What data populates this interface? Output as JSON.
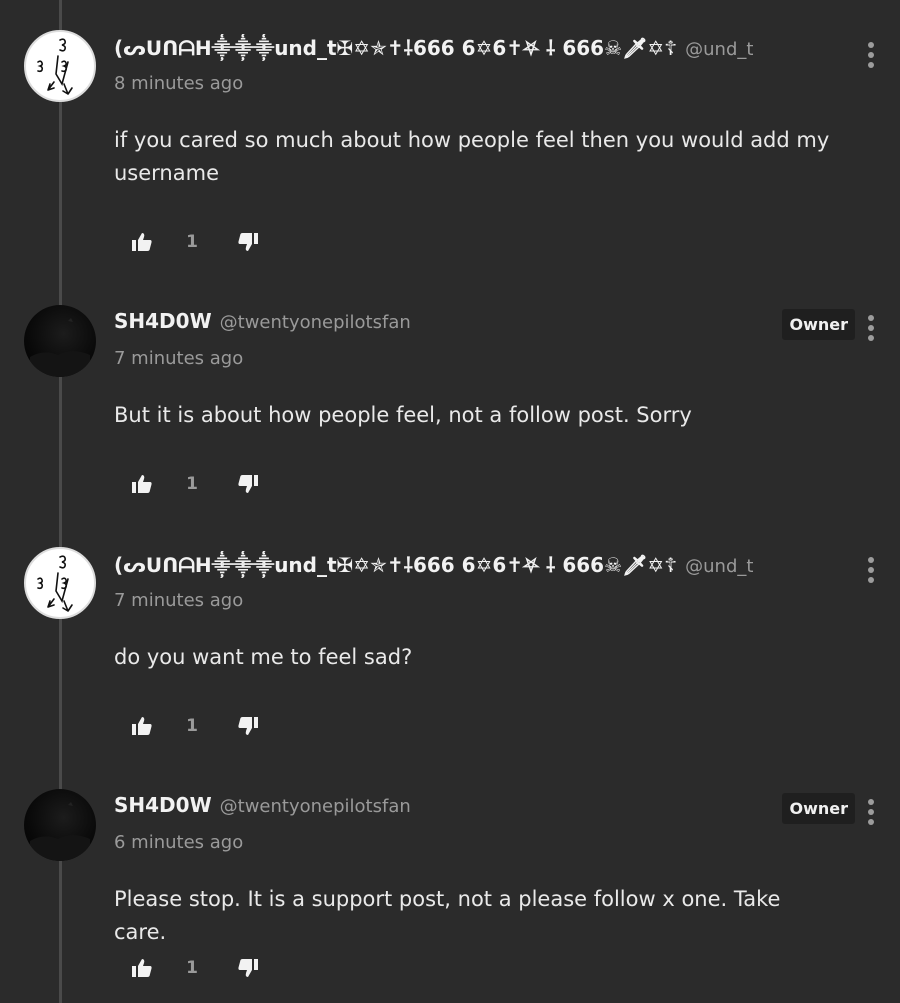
{
  "comments": [
    {
      "avatar": "sigil-avatar",
      "display_name": "(ᔕᑌᑎᗩᕼ⸎⸎⸎und_t✠✡✯✝⸸666 6✡6✝⛧ ⸸ 666☠🗡✡☦",
      "handle": "@und_t",
      "time": "8 minutes ago",
      "text": "if you cared so much about how people feel then you would add my username",
      "likes": "1",
      "owner": false
    },
    {
      "avatar": "dark-avatar",
      "display_name": "SH4D0W",
      "handle": "@twentyonepilotsfan",
      "time": "7 minutes ago",
      "text": "But it is about how people feel, not a follow post. Sorry",
      "likes": "1",
      "owner": true,
      "owner_label": "Owner"
    },
    {
      "avatar": "sigil-avatar",
      "display_name": "(ᔕᑌᑎᗩᕼ⸎⸎⸎und_t✠✡✯✝⸸666 6✡6✝⛧ ⸸ 666☠🗡✡☦",
      "handle": "@und_t",
      "time": "7 minutes ago",
      "text": "do you want me to feel sad?",
      "likes": "1",
      "owner": false
    },
    {
      "avatar": "dark-avatar",
      "display_name": "SH4D0W",
      "handle": "@twentyonepilotsfan",
      "time": "6 minutes ago",
      "text": "Please stop. It is a support post, not a please follow x one. Take care.",
      "likes": "1",
      "owner": true,
      "owner_label": "Owner"
    }
  ]
}
